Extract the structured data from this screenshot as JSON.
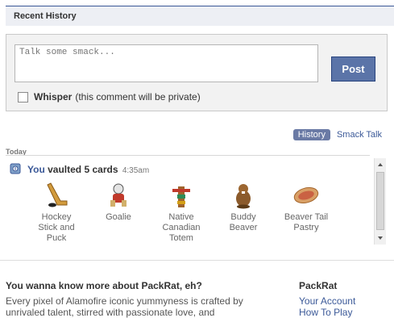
{
  "header": {
    "title": "Recent History"
  },
  "composer": {
    "placeholder": "Talk some smack...",
    "post_label": "Post",
    "whisper_label": "Whisper",
    "whisper_note": "(this comment will be private)"
  },
  "tabs": {
    "history": "History",
    "smack_talk": "Smack Talk"
  },
  "feed": {
    "day": "Today",
    "actor": "You",
    "action": "vaulted 5 cards",
    "time": "4:35am",
    "cards": [
      "Hockey Stick and Puck",
      "Goalie",
      "Native Canadian Totem",
      "Buddy Beaver",
      "Beaver Tail Pastry"
    ]
  },
  "more": {
    "title": "You wanna know more about PackRat, eh?",
    "text": "Every pixel of Alamofire iconic yummyness is crafted by unrivaled talent, stirred with passionate love, and"
  },
  "sidebar": {
    "title": "PackRat",
    "links": [
      "Your Account",
      "How To Play"
    ]
  }
}
